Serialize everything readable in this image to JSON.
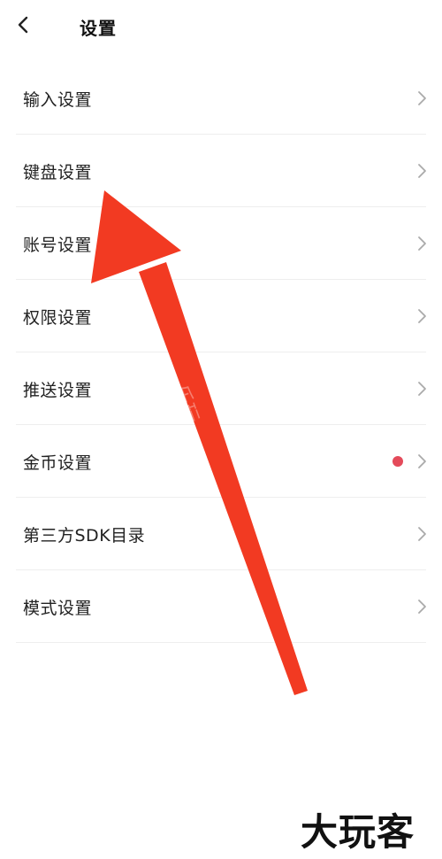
{
  "header": {
    "title": "设置"
  },
  "settings": {
    "items": [
      {
        "label": "输入设置"
      },
      {
        "label": "键盘设置"
      },
      {
        "label": "账号设置"
      },
      {
        "label": "权限设置"
      },
      {
        "label": "推送设置"
      },
      {
        "label": "金币设置",
        "has_dot": true
      },
      {
        "label": "第三方SDK目录"
      },
      {
        "label": "模式设置"
      }
    ]
  },
  "colors": {
    "arrow": "#f23a22",
    "dot": "#e44a5a",
    "chevron": "#aaaaaa",
    "divider": "#eeeeee"
  },
  "watermark": {
    "brand": "大玩客",
    "faint": "乐玩"
  }
}
